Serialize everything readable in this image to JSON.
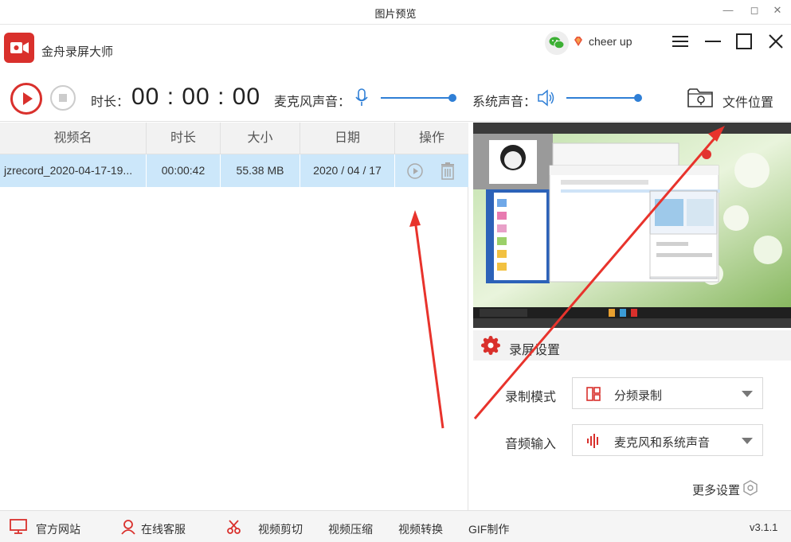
{
  "window": {
    "title": "图片预览"
  },
  "app": {
    "name": "金舟录屏大师",
    "username": "cheer up"
  },
  "controls": {
    "duration_label": "时长：",
    "duration_value": "00 : 00 : 00",
    "mic_label": "麦克风声音：",
    "mic_level": 1.0,
    "system_label": "系统声音：",
    "system_level": 1.0,
    "file_location_label": "文件位置"
  },
  "table": {
    "columns": [
      "视频名",
      "时长",
      "大小",
      "日期",
      "操作"
    ],
    "rows": [
      {
        "name": "jzrecord_2020-04-17-19...",
        "duration": "00:00:42",
        "size": "55.38 MB",
        "date": "2020 / 04 / 17"
      }
    ]
  },
  "settings": {
    "title": "录屏设置",
    "mode_label": "录制模式",
    "mode_value": "分频录制",
    "audio_label": "音频输入",
    "audio_value": "麦克风和系统声音",
    "more_label": "更多设置"
  },
  "bottom": {
    "items": [
      "官方网站",
      "在线客服",
      "视频剪切",
      "视频压缩",
      "视频转换",
      "GIF制作"
    ],
    "version": "v3.1.1"
  },
  "colors": {
    "accent": "#d9302c",
    "slider": "#2f7fd6",
    "selected_row": "#cce7fa"
  }
}
